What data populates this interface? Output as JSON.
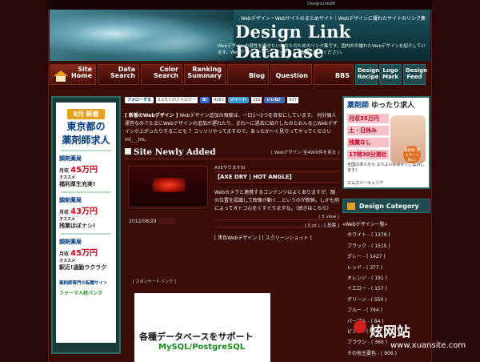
{
  "topstrip": {
    "logo": "DesignLinkDB"
  },
  "header": {
    "tagline": "Webデザイン・Webサイトのまとめサイト｜Webデザインに優れたサイトのリンク集",
    "title": "Design Link Database",
    "description": "Webデザインの感性を磨きたいあなたのためのリンク集です。国内外の優れたWebデザインを紹介しています。Webデザイナーのインプットとして是非ご活用ください。"
  },
  "nav": {
    "home": [
      "Site",
      "Home"
    ],
    "items": [
      {
        "l1": "Data",
        "l2": "Search"
      },
      {
        "l1": "Color",
        "l2": "Search"
      },
      {
        "l1": "Ranking",
        "l2": "Summary"
      },
      {
        "l1": "",
        "l2": "Blog"
      },
      {
        "l1": "",
        "l2": "Question"
      },
      {
        "l1": "",
        "l2": "BBS"
      }
    ],
    "right": [
      {
        "l1": "Design",
        "l2": "Recipe"
      },
      {
        "l1": "Logo",
        "l2": "Mark"
      },
      {
        "l1": "Design",
        "l2": "Feed"
      }
    ]
  },
  "left_ad": {
    "month": "8月 新着",
    "title1": "東京都の",
    "title2": "薬剤師求人",
    "shops": [
      {
        "name": "調剤薬局",
        "pay_label": "月収",
        "pay": "45万円",
        "sub": "オススメ",
        "hl": "福利厚生充実!"
      },
      {
        "name": "調剤薬局",
        "pay_label": "月収",
        "pay": "43万円",
        "sub": "オススメ",
        "hl": "残業ほぼナシ!"
      },
      {
        "name": "調剤薬局",
        "pay_label": "月収",
        "pay": "45万円",
        "sub": "オススメ",
        "hl": "駅近!通勤ラクラク"
      }
    ],
    "footer1": "薬剤師専門の転職サイト",
    "footer2": "ファーマ人材バンク"
  },
  "social": {
    "follow": "フォローする",
    "followers": "3.1万人のフォロワー",
    "b_count": "4183",
    "tweet": "ツイート",
    "tweet_count": "319",
    "like": "いいね！",
    "like_count": "617"
  },
  "news": {
    "label": "新着のWebデザイン",
    "text": "Webデザイン追加の頻度は、一日1〜2つを目安にしています。 何分個人運営なのでたまにWebデザインの追加が遅れたり、まれ〜に過去に紹介したのとおんなじWebデザインが上がったりすることも ？コッソリやってますので、あったか〜く見守ってやってくださいm(_ _)m。"
  },
  "section": {
    "title": "Site Newly Added",
    "meta": "[ Webデザイン 全4906件を見る ]"
  },
  "entry": {
    "tagline": "AXEやりますね",
    "title": "【AXE DRY | HOT ANGLE】",
    "desc": "Webカメラと連携するコンテンツはよくありますが、顔の位置を認識して映像が動く…というのが新鮮。しかも例によってオトコ心をくすぐりますな。（続きはこちら）",
    "views": "( 5 view )",
    "pt": "( 0 pt ) -",
    "vote": "[ 投票 ]",
    "tags": "[ 黒色Webデザイン ] [ スクリーンショット ]",
    "date": "2012/08/29"
  },
  "sponsored": {
    "label": "[ スポンサード リンク ]",
    "text1": "各種データベースをサポート",
    "text2": "MySQL/PostgreSQL"
  },
  "right_ad": {
    "title_a": "薬剤師",
    "title_b": "ゆったり求人",
    "p1": "月収35万円",
    "p2": "土・日休み",
    "p3": "残業なし",
    "p4": "17時30分退社",
    "note": "全国の求人から よりよい好条件でご案内します！",
    "badge": "薬剤師 求人サイト No.1",
    "footer": "エムスリーキャリア"
  },
  "category": {
    "title": "Design Category",
    "top": "«Webデザイン一覧»",
    "items": [
      "ホワイト - ( 1379 )",
      "ブラック - ( 1515 )",
      "グレー - ( 1427 )",
      "レッド - ( 377 )",
      "オレンジ - ( 191 )",
      "イエロー - ( 157 )",
      "グリーン - ( 550 )",
      "ブルー - ( 794 )",
      "パープル - ( 84 )",
      "ピンク - ( 99 )",
      "ブラウン - ( 360 )",
      "その他主要色 - ( 906 )"
    ]
  },
  "watermark": {
    "cn": "炫网站",
    "en": "www.xuansite.com"
  }
}
